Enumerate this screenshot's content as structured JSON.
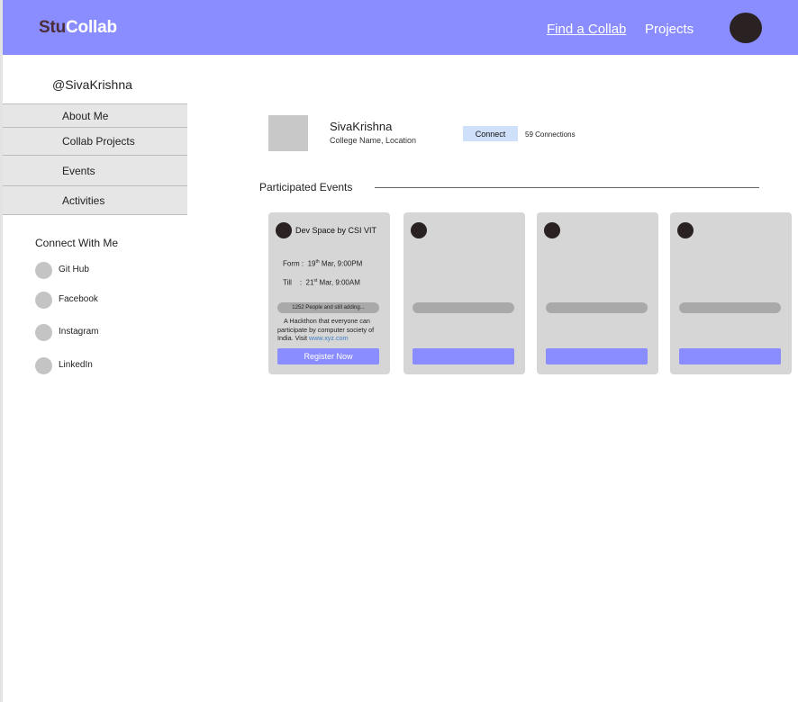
{
  "header": {
    "logo_part1": "Stu",
    "logo_part2": "Collab",
    "nav": [
      {
        "label": "Find a Collab"
      },
      {
        "label": "Projects"
      }
    ]
  },
  "sidebar": {
    "username": "@SivaKrishna",
    "items": [
      {
        "label": "About Me"
      },
      {
        "label": "Collab Projects"
      },
      {
        "label": "Events"
      },
      {
        "label": "Activities"
      }
    ],
    "connect_title": "Connect With Me",
    "socials": [
      {
        "label": "Git Hub"
      },
      {
        "label": "Facebook"
      },
      {
        "label": "Instagram"
      },
      {
        "label": "LinkedIn"
      }
    ]
  },
  "profile": {
    "name": "SivaKrishna",
    "subtitle": "College Name, Location",
    "connect_label": "Connect",
    "connections": "59 Connections"
  },
  "events_section": {
    "title": "Participated Events",
    "cards": [
      {
        "title": "Dev Space by CSI VIT",
        "from_label": "Form :",
        "from_day": "19",
        "from_suffix": "th",
        "from_rest": "Mar, 9:00PM",
        "till_label": "Till",
        "till_sep": ":",
        "till_day": "21",
        "till_suffix": "st",
        "till_rest": "Mar, 9:00AM",
        "participants": "1252 People  and still adding...",
        "description": "A Hackthon that everyone can participate by computer society of India. Visit",
        "link": "www.xyz.com",
        "button": "Register Now"
      }
    ]
  },
  "colors": {
    "accent": "#8a8dff",
    "logo_dark": "#4a2d38",
    "card_bg": "#d6d6d6",
    "connect_btn": "#cfe0fb"
  }
}
